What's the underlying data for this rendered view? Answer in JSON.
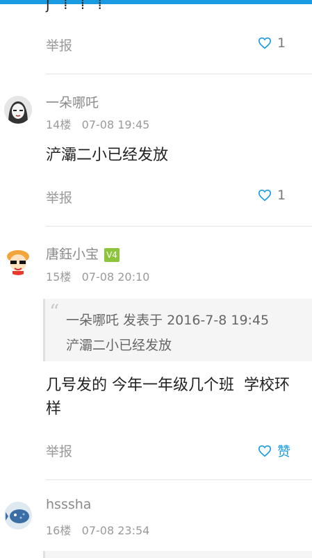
{
  "partial_top_text": "ʃ ⁞ ⁞ ⁞",
  "posts": [
    {
      "report_label": "举报",
      "like_count": "1"
    },
    {
      "username": "一朵哪吒",
      "floor": "14楼",
      "time": "07-08 19:45",
      "content": "浐灞二小已经发放",
      "report_label": "举报",
      "like_count": "1"
    },
    {
      "username": "唐鈺小宝",
      "badge": "V4",
      "floor": "15楼",
      "time": "07-08 20:10",
      "quote": {
        "header": "一朵哪吒 发表于 2016-7-8 19:45",
        "text": "浐灞二小已经发放"
      },
      "content_line1": "几号发的 今年一年级几个班  学校环",
      "content_line2": "样",
      "report_label": "举报",
      "like_label": "赞"
    },
    {
      "username": "hsssha",
      "floor": "16楼",
      "time": "07-08 23:54"
    }
  ],
  "colors": {
    "accent": "#1a9ae0",
    "muted": "#9a9a9a",
    "text": "#222222"
  }
}
